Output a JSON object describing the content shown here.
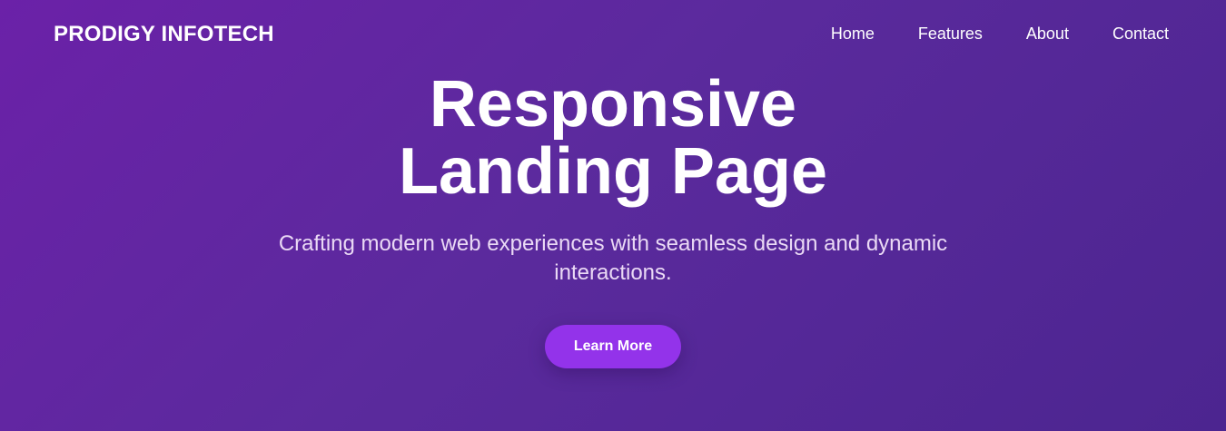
{
  "header": {
    "logo": "PRODIGY INFOTECH",
    "nav": [
      {
        "label": "Home"
      },
      {
        "label": "Features"
      },
      {
        "label": "About"
      },
      {
        "label": "Contact"
      }
    ]
  },
  "hero": {
    "title_line1": "Responsive",
    "title_line2": "Landing Page",
    "subtitle": "Crafting modern web experiences with seamless design and dynamic interactions.",
    "cta_label": "Learn More"
  },
  "colors": {
    "background_start": "#6b21a8",
    "background_end": "#4c2590",
    "button": "#9333ea",
    "text": "#ffffff",
    "subtitle_text": "#ead9f5"
  }
}
